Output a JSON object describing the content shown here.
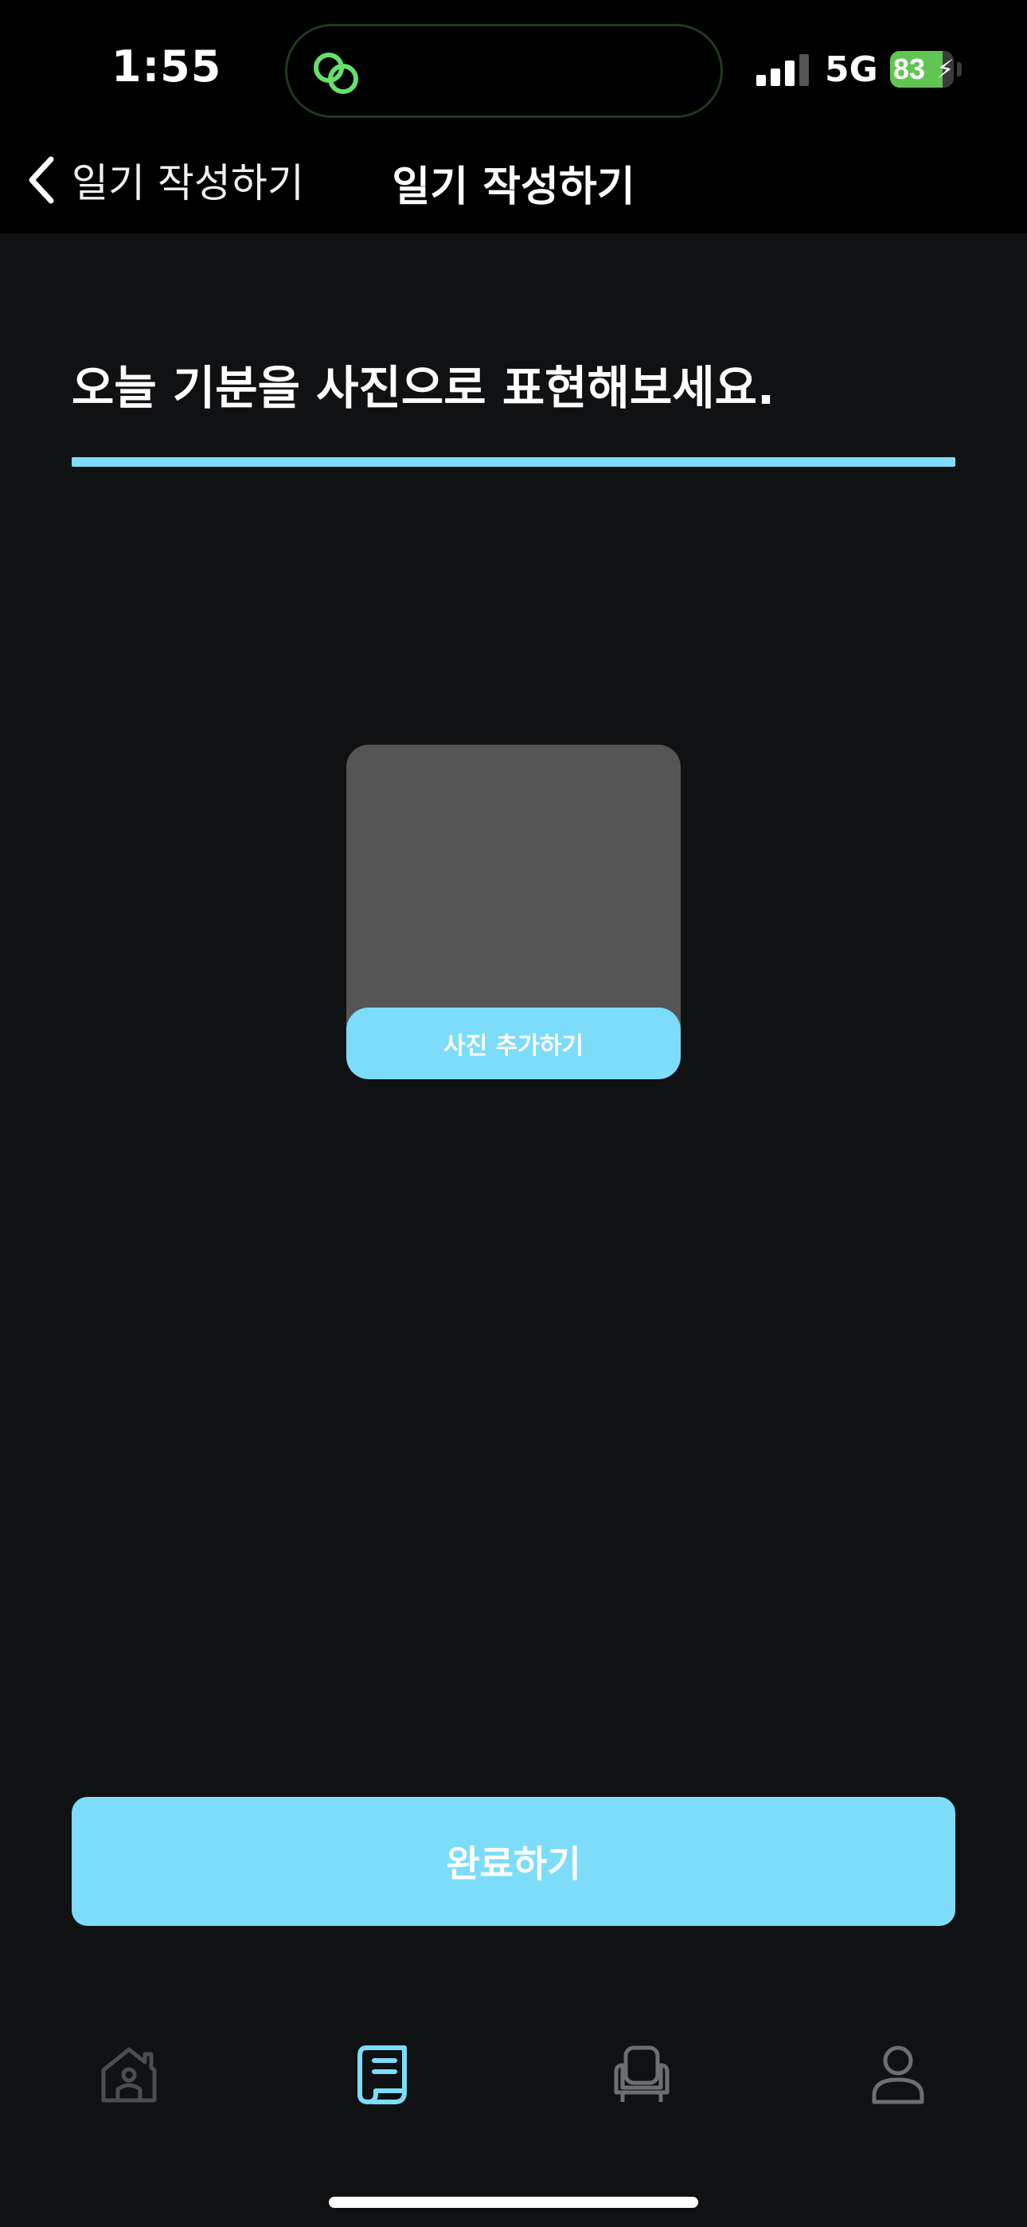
{
  "status_bar": {
    "time": "1:55",
    "network": "5G",
    "battery": "83",
    "battery_level": 0.83,
    "icons": [
      "link-icon",
      "signal-icon",
      "battery-icon",
      "charging-bolt-icon"
    ]
  },
  "nav": {
    "back_label": "일기 작성하기",
    "title": "일기 작성하기"
  },
  "main": {
    "question": "오늘 기분을 사진으로 표현해보세요.",
    "progress": 1.0,
    "add_photo_label": "사진 추가하기",
    "complete_label": "완료하기"
  },
  "tabbar": {
    "items": [
      {
        "icon": "home-icon",
        "active": false
      },
      {
        "icon": "diary-icon",
        "active": true
      },
      {
        "icon": "chair-icon",
        "active": false
      },
      {
        "icon": "profile-icon",
        "active": false
      }
    ]
  },
  "colors": {
    "accent": "#7cdcfa",
    "background": "#101113",
    "header": "#000000",
    "photo_placeholder": "#555555",
    "inactive_icon": "#6b6e73"
  }
}
